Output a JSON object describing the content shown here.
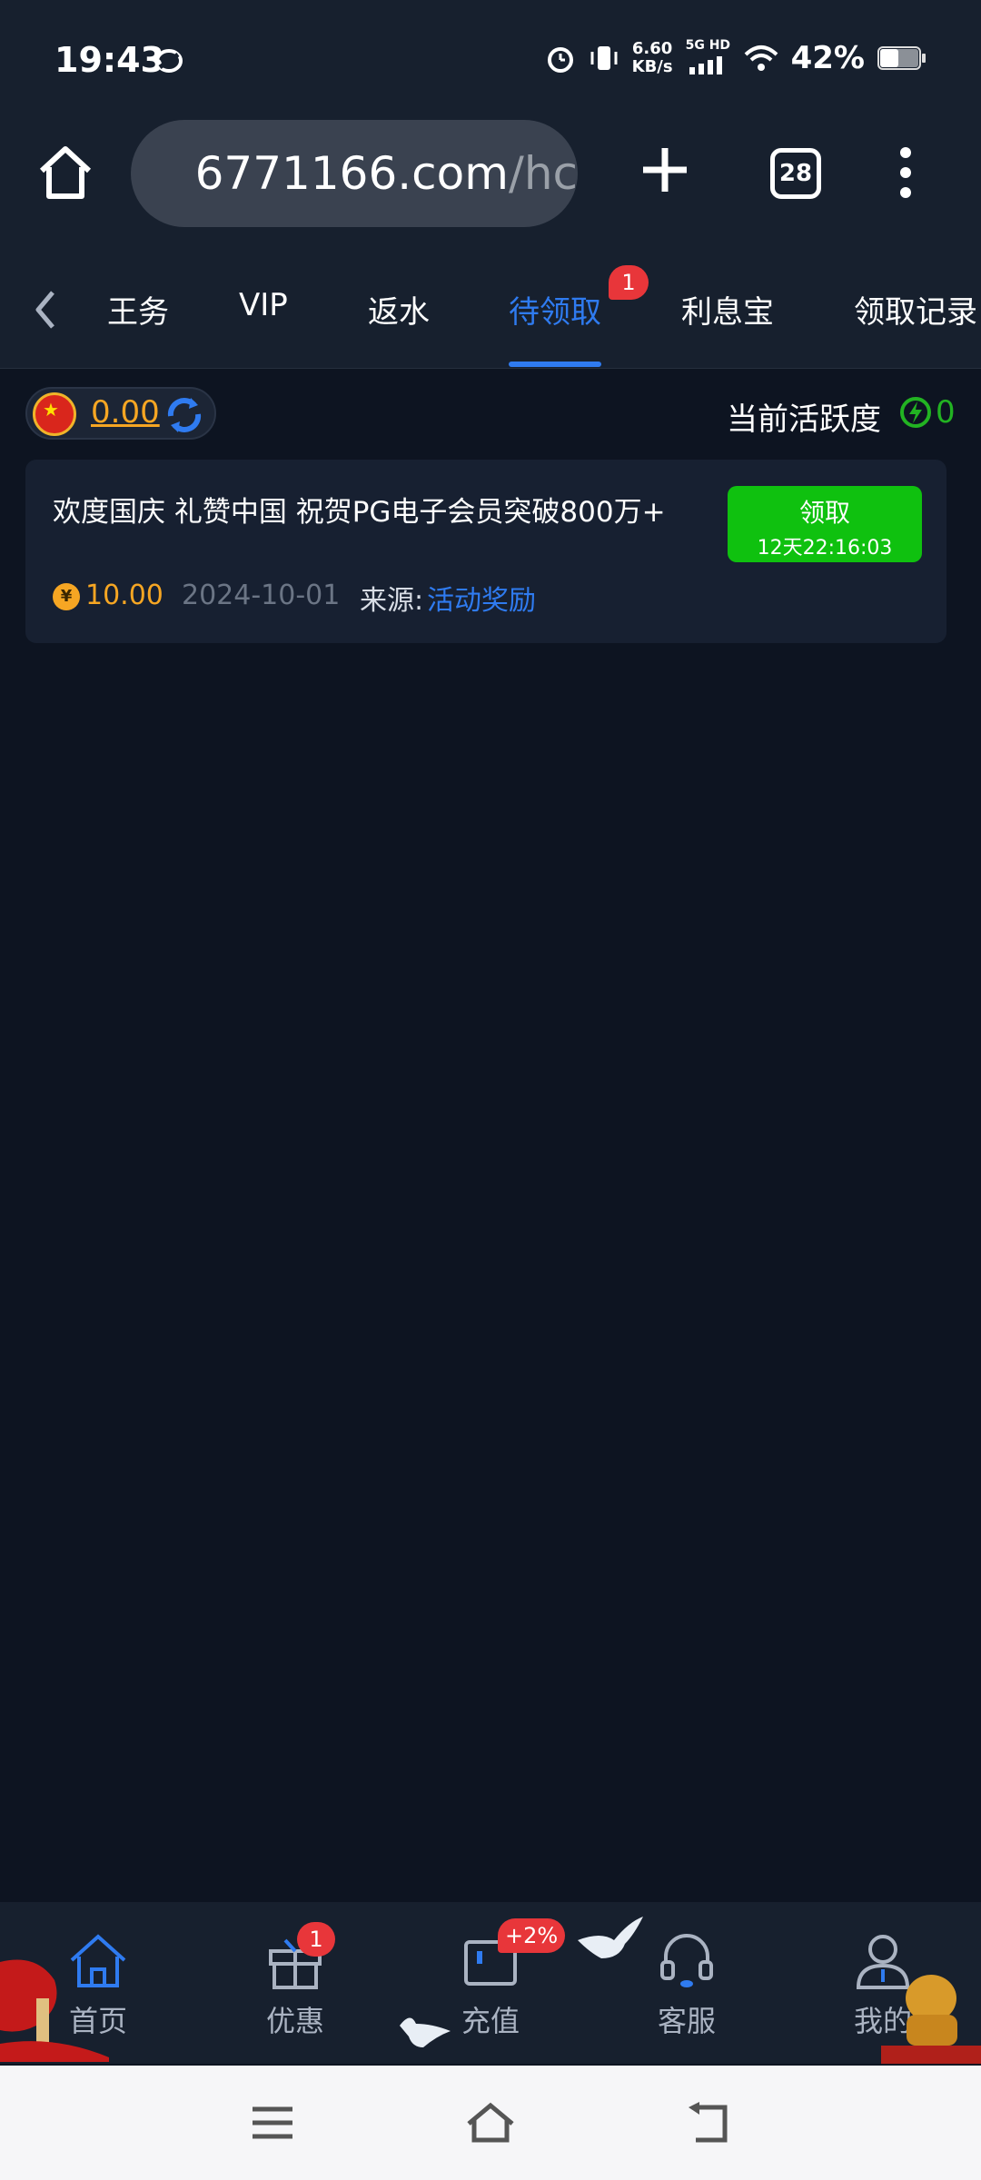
{
  "status_bar": {
    "time": "19:43",
    "net_speed_value": "6.60",
    "net_speed_unit": "KB/s",
    "network": "5G HD",
    "battery": "42%"
  },
  "browser": {
    "url_domain": "6771166.com",
    "url_path": "/hc",
    "tab_count": "28"
  },
  "tabs": {
    "items": [
      "王务",
      "VIP",
      "返水",
      "待领取",
      "利息宝",
      "领取记录"
    ],
    "active_index": 3,
    "active_badge": "1"
  },
  "balance": {
    "value": "0.00"
  },
  "activity": {
    "label": "当前活跃度",
    "value": "0"
  },
  "reward_card": {
    "title": "欢度国庆 礼赞中国 祝贺PG电子会员突破800万+",
    "claim_label": "领取",
    "claim_timer": "12天22:16:03",
    "coin_symbol": "¥",
    "amount": "10.00",
    "date": "2024-10-01",
    "source_label": "来源:",
    "source_link": "活动奖励"
  },
  "bottom_nav": {
    "items": [
      {
        "label": "首页",
        "icon": "home-icon"
      },
      {
        "label": "优惠",
        "icon": "gift-icon",
        "badge": "1"
      },
      {
        "label": "充值",
        "icon": "wallet-icon",
        "badge": "+2%"
      },
      {
        "label": "客服",
        "icon": "headset-icon"
      },
      {
        "label": "我的",
        "icon": "user-icon"
      }
    ]
  },
  "colors": {
    "background": "#0d1421",
    "accent_blue": "#2f7bf0",
    "claim_green": "#0fc10f",
    "gold": "#f6a623",
    "badge_red": "#e8363a"
  }
}
